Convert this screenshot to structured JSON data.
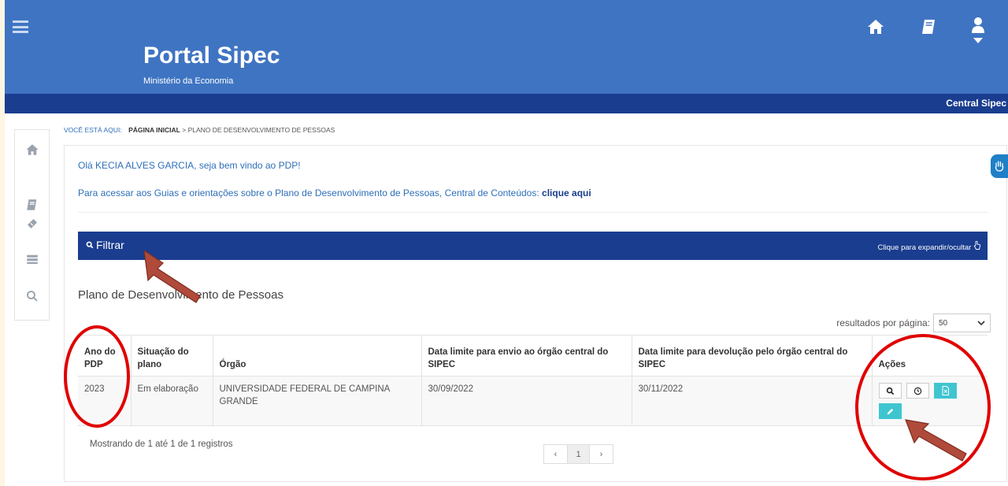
{
  "header": {
    "menu_icon": "hamburger-icon",
    "title": "Portal Sipec",
    "subtitle": "Ministério da Economia",
    "icons": [
      "home-icon",
      "book-icon",
      "user-icon"
    ]
  },
  "band": {
    "label": "Central Sipec"
  },
  "sidebar": {
    "icons": [
      "home-icon",
      "book-icon",
      "ticket-icon",
      "server-icon",
      "search-icon"
    ]
  },
  "breadcrumb": {
    "you_are_here": "VOCÊ ESTÁ AQUI:",
    "home": "PÁGINA INICIAL",
    "separator": ">",
    "current": "PLANO DE DESENVOLVIMENTO DE PESSOAS"
  },
  "main": {
    "welcome": "Olá KECIA ALVES GARCIA, seja bem vindo ao PDP!",
    "guide_text": "Para acessar aos Guias e orientações sobre o Plano de Desenvolvimento de Pessoas, Central de Conteúdos:",
    "guide_link": "clique aqui",
    "filter_label": "Filtrar",
    "expand_label": "Clique para expandir/ocultar",
    "section_title": "Plano de Desenvolvimento de Pessoas",
    "results_label": "resultados por página:",
    "results_value": "50",
    "showing": "Mostrando de 1 até 1 de 1 registros"
  },
  "table": {
    "headers": [
      "Ano do PDP",
      "Situação do plano",
      "Órgão",
      "Data limite para envio ao órgão central do SIPEC",
      "Data limite para devolução pelo órgão central do SIPEC",
      "Ações"
    ],
    "rows": [
      [
        "2023",
        "Em elaboração",
        "UNIVERSIDADE FEDERAL DE CAMPINA GRANDE",
        "30/09/2022",
        "30/11/2022"
      ]
    ],
    "action_icons": [
      "search-icon",
      "clock-icon",
      "document-icon",
      "pencil-icon"
    ]
  },
  "pagination": {
    "prev": "‹",
    "page": "1",
    "next": "›"
  },
  "colors": {
    "header_bg": "#3f74c2",
    "band_bg": "#1a3d8f",
    "accent": "#2f6fba",
    "teal": "#3fc5d0",
    "annotation": "#e00000",
    "arrow": "#b04a3a",
    "frame": "#fdf6e3"
  }
}
